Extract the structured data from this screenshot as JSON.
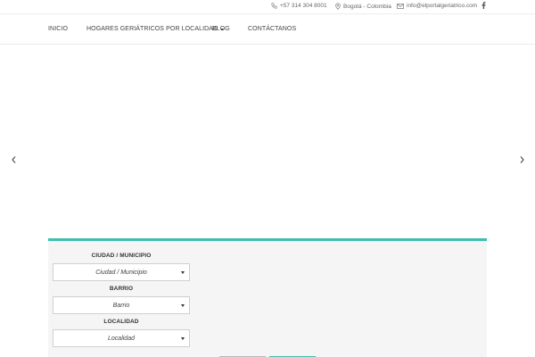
{
  "topbar": {
    "phone": "+57 314 304 8001",
    "city": "Bogotá - Colombia",
    "email": "info@elportalgeriatrico.com",
    "icons": {
      "phone": "phone-icon",
      "city": "map-pin-icon",
      "email": "mail-icon",
      "social": "facebook-icon"
    }
  },
  "nav": {
    "items": [
      {
        "label": "INICIO"
      },
      {
        "label": "HOGARES GERIÁTRICOS POR LOCALIDAD"
      },
      {
        "label": "BLOG"
      },
      {
        "label": "CONTÁCTANOS"
      }
    ]
  },
  "slider": {
    "icons": {
      "prev": "chevron-left-icon",
      "next": "chevron-right-icon"
    }
  },
  "search": {
    "accent": "#3dbfae",
    "fields": [
      {
        "label": "CIUDAD / MUNICIPIO",
        "value": "Ciudad / Municipio"
      },
      {
        "label": "BARRIO",
        "value": "Barrio"
      },
      {
        "label": "LOCALIDAD",
        "value": "Localidad"
      }
    ]
  }
}
